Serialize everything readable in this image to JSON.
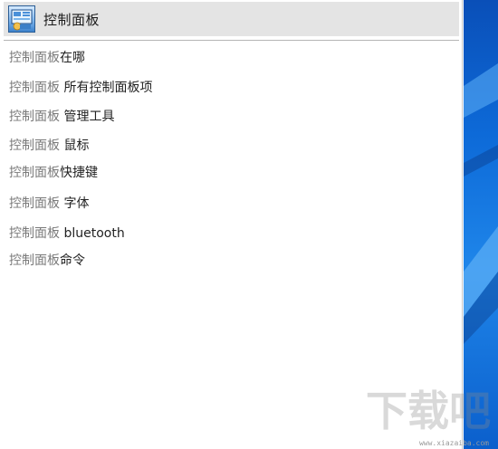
{
  "best_match": {
    "icon": "control-panel-icon",
    "label": "控制面板"
  },
  "suggestions": [
    {
      "query": "控制面板",
      "rest": "在哪"
    },
    {
      "query": "控制面板",
      "rest": " 所有控制面板项"
    },
    {
      "query": "控制面板",
      "rest": " 管理工具"
    },
    {
      "query": "控制面板",
      "rest": " 鼠标"
    },
    {
      "query": "控制面板",
      "rest": "快捷键"
    },
    {
      "query": "控制面板",
      "rest": " 字体"
    },
    {
      "query": "控制面板",
      "rest": " bluetooth"
    },
    {
      "query": "控制面板",
      "rest": "命令"
    }
  ],
  "watermark": {
    "text": "下载吧",
    "url": "www.xiazaiba.com"
  },
  "colors": {
    "selection_bg": "#e4e4e4",
    "query_text": "#7a7a7a",
    "completion_text": "#222222",
    "desktop_blue": "#0d6ad8"
  }
}
